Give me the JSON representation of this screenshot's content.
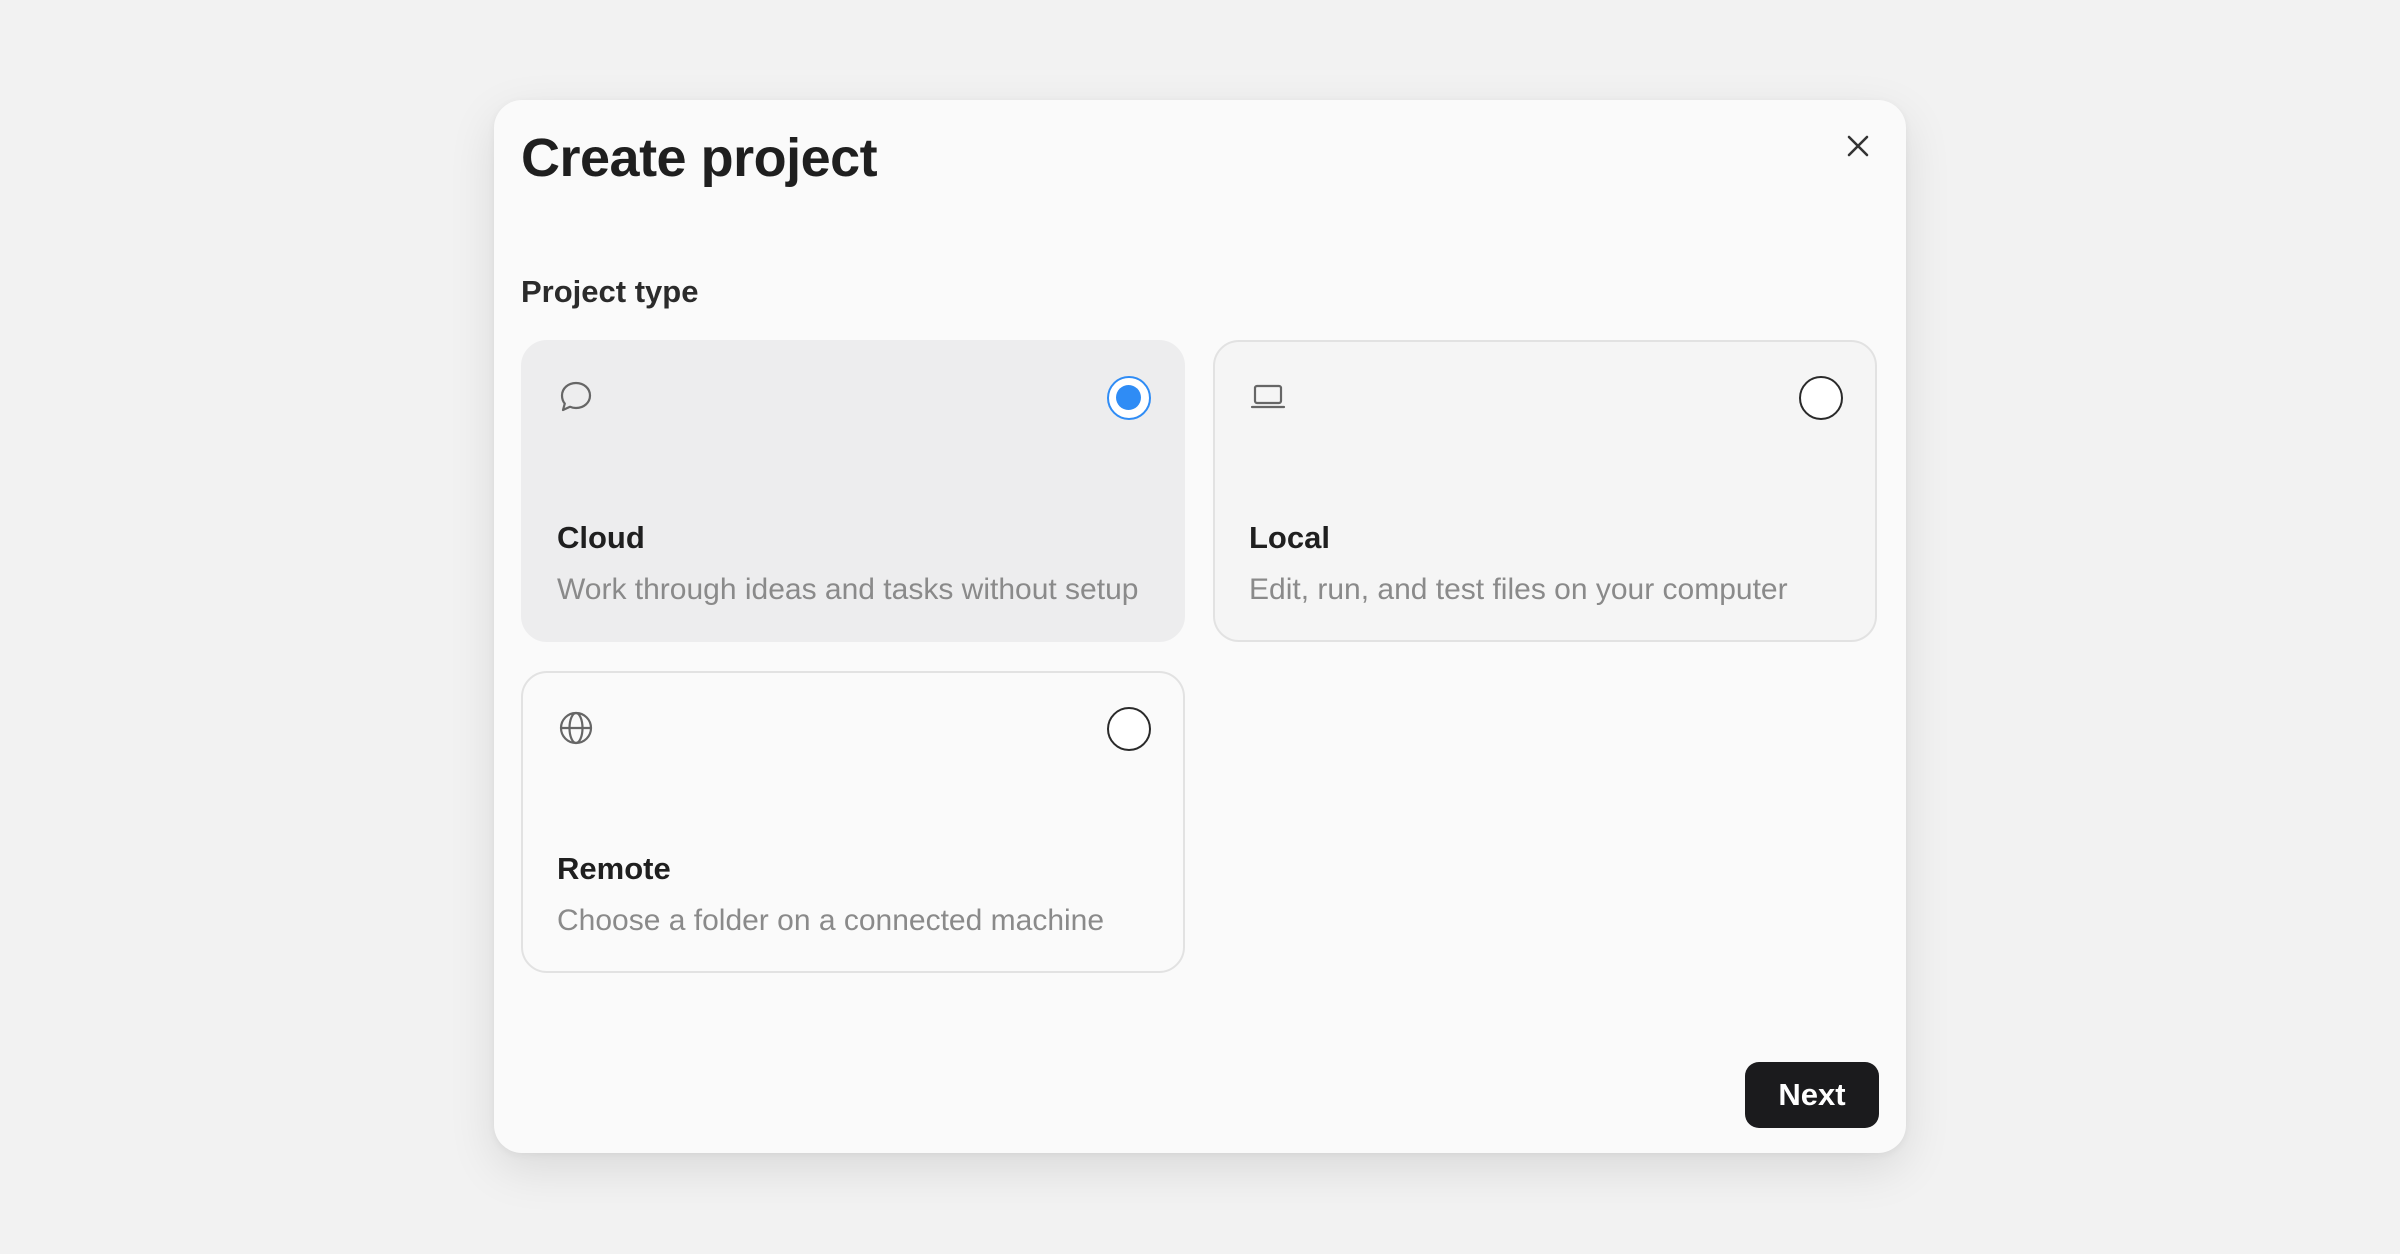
{
  "dialog": {
    "title": "Create project",
    "close_icon": "close-icon",
    "section_label": "Project type",
    "options": [
      {
        "icon": "chat-bubble-icon",
        "title": "Cloud",
        "description": "Work through ideas and tasks without setup",
        "selected": true
      },
      {
        "icon": "laptop-icon",
        "title": "Local",
        "description": "Edit, run, and test files on your computer",
        "selected": false
      },
      {
        "icon": "globe-icon",
        "title": "Remote",
        "description": "Choose a folder on a connected machine",
        "selected": false
      }
    ],
    "next_label": "Next"
  },
  "colors": {
    "accent": "#2f8cf5",
    "primary_button": "#1b1b1d",
    "muted_text": "#8a8a8a"
  }
}
